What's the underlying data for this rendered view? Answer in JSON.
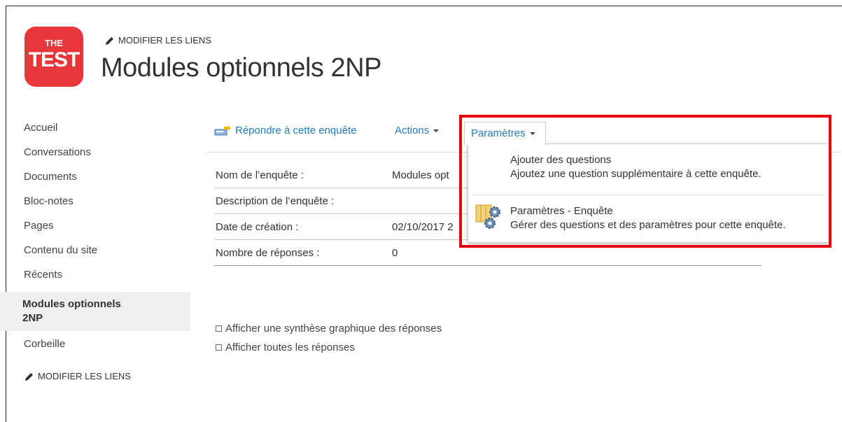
{
  "logo": {
    "line1": "THE",
    "line2": "TEST"
  },
  "header": {
    "edit_links": "MODIFIER LES LIENS",
    "site_title": "Modules optionnels 2NP"
  },
  "nav": {
    "items": [
      {
        "label": "Accueil"
      },
      {
        "label": "Conversations"
      },
      {
        "label": "Documents"
      },
      {
        "label": "Bloc-notes"
      },
      {
        "label": "Pages"
      },
      {
        "label": "Contenu du site"
      },
      {
        "label": "Récents"
      }
    ],
    "selected": "Modules optionnels 2NP",
    "after_selected": "Corbeille",
    "edit_links": "MODIFIER LES LIENS"
  },
  "toolbar": {
    "respond": "Répondre à cette enquête",
    "actions": "Actions",
    "parametres": "Paramètres"
  },
  "properties": [
    {
      "label": "Nom de l’enquête :",
      "value": "Modules opt"
    },
    {
      "label": "Description de l’enquête :",
      "value": ""
    },
    {
      "label": "Date de création :",
      "value": "02/10/2017 2"
    },
    {
      "label": "Nombre de réponses :",
      "value": "0"
    }
  ],
  "links": {
    "summary": "Afficher une synthèse graphique des réponses",
    "all": "Afficher toutes les réponses"
  },
  "menu": {
    "item1_title": "Ajouter des questions",
    "item1_desc": "Ajoutez une question supplémentaire à cette enquête.",
    "item2_title": "Paramètres - Enquête",
    "item2_desc": "Gérer des questions et des paramètres pour cette enquête."
  },
  "colors": {
    "accent": "#1f7bc1",
    "highlight": "#e8000b",
    "logo": "#e8373b"
  }
}
